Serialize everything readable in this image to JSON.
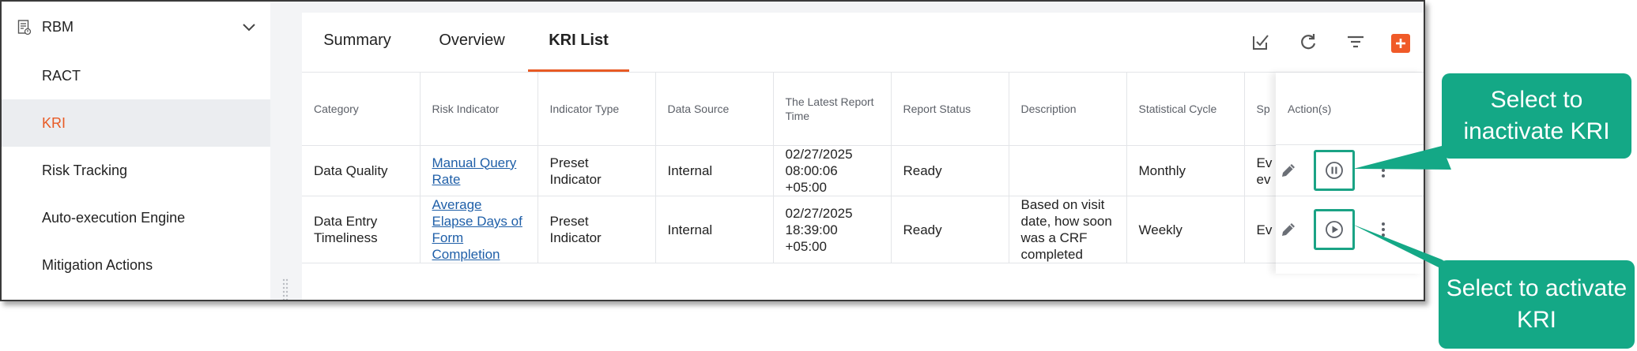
{
  "sidebar": {
    "header": {
      "title": "RBM",
      "icon": "document-report-icon",
      "chevron": "chevron-down-icon"
    },
    "items": [
      {
        "label": "RACT",
        "active": false
      },
      {
        "label": "KRI",
        "active": true
      },
      {
        "label": "Risk Tracking",
        "active": false
      },
      {
        "label": "Auto-execution Engine",
        "active": false
      },
      {
        "label": "Mitigation Actions",
        "active": false
      }
    ]
  },
  "tabs": [
    {
      "label": "Summary",
      "active": false
    },
    {
      "label": "Overview",
      "active": false
    },
    {
      "label": "KRI List",
      "active": true
    }
  ],
  "toolbar": {
    "icons": [
      "batch-edit-icon",
      "refresh-icon",
      "filter-icon",
      "add-icon"
    ],
    "accent_color": "#f05a28"
  },
  "table": {
    "columns": [
      "Category",
      "Risk Indicator",
      "Indicator Type",
      "Data Source",
      "The Latest Report Time",
      "Report Status",
      "Description",
      "Statistical Cycle",
      "Sp"
    ],
    "actions_header": "Action(s)",
    "rows": [
      {
        "category": "Data Quality",
        "risk_indicator": "Manual Query Rate",
        "indicator_type": "Preset Indicator",
        "data_source": "Internal",
        "latest_report_time": "02/27/2025 08:00:06 +05:00",
        "report_status": "Ready",
        "description": "",
        "statistical_cycle": "Monthly",
        "sp": "Ev ev",
        "state_action": "pause-circle-icon"
      },
      {
        "category": "Data Entry Timeliness",
        "risk_indicator": "Average Elapse Days of Form Completion",
        "indicator_type": "Preset Indicator",
        "data_source": "Internal",
        "latest_report_time": "02/27/2025 18:39:00 +05:00",
        "report_status": "Ready",
        "description": "Based on visit date, how soon was a CRF completed",
        "statistical_cycle": "Weekly",
        "sp": "Ev",
        "state_action": "play-circle-icon"
      }
    ]
  },
  "callouts": {
    "inactivate": "Select to inactivate KRI",
    "activate": "Select to activate KRI",
    "color": "#14a886"
  },
  "colors": {
    "accent": "#e85a24",
    "link": "#1f5fa8",
    "highlight": "#1aa385"
  }
}
